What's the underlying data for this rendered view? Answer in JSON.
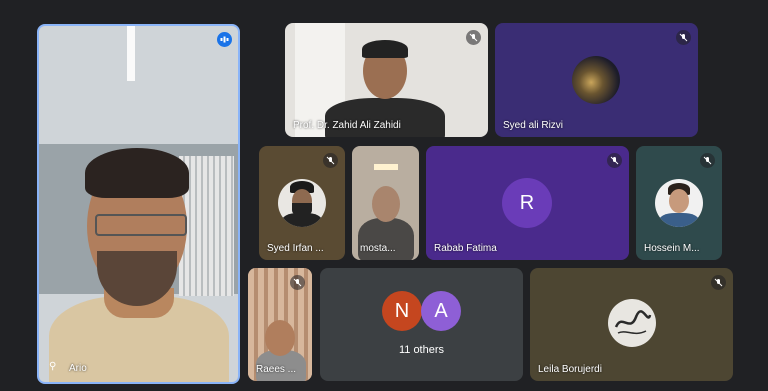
{
  "participants": {
    "active_speaker": {
      "name": "Ario"
    },
    "zahidi": {
      "name": "Prof. Dr. Zahid Ali Zahidi"
    },
    "rizvi": {
      "name": "Syed ali Rizvi"
    },
    "irfan": {
      "name": "Syed Irfan ..."
    },
    "mosta": {
      "name": "mosta..."
    },
    "rabab": {
      "name": "Rabab Fatima",
      "initial": "R"
    },
    "hossein": {
      "name": "Hossein M..."
    },
    "raees": {
      "name": "Raees ..."
    },
    "others": {
      "count_label": "11 others",
      "initials": [
        "N",
        "A"
      ]
    },
    "leila": {
      "name": "Leila Borujerdi"
    }
  },
  "colors": {
    "background": "#202124",
    "active_border": "#8ab4f8",
    "rabab_tile": "#4a2a8c",
    "rabab_avatar": "#6a3cb8",
    "avatar_n": "#c5461f",
    "avatar_a": "#8e5fd6"
  },
  "icons": {
    "muted": "mic-off-icon",
    "speaking": "audio-level-icon"
  }
}
